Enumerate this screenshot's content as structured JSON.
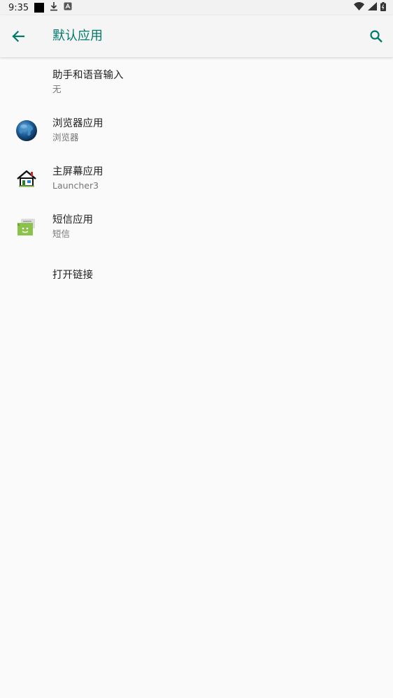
{
  "status_bar": {
    "time": "9:35"
  },
  "app_bar": {
    "title": "默认应用"
  },
  "items": [
    {
      "title": "助手和语音输入",
      "subtitle": "无"
    },
    {
      "title": "浏览器应用",
      "subtitle": "浏览器",
      "icon": "globe-icon"
    },
    {
      "title": "主屏幕应用",
      "subtitle": "Launcher3",
      "icon": "home-icon"
    },
    {
      "title": "短信应用",
      "subtitle": "短信",
      "icon": "messaging-icon"
    },
    {
      "title": "打开链接"
    }
  ],
  "colors": {
    "accent": "#00796b",
    "background": "#fafafa",
    "primary_text": "#212121",
    "secondary_text": "#757575"
  }
}
